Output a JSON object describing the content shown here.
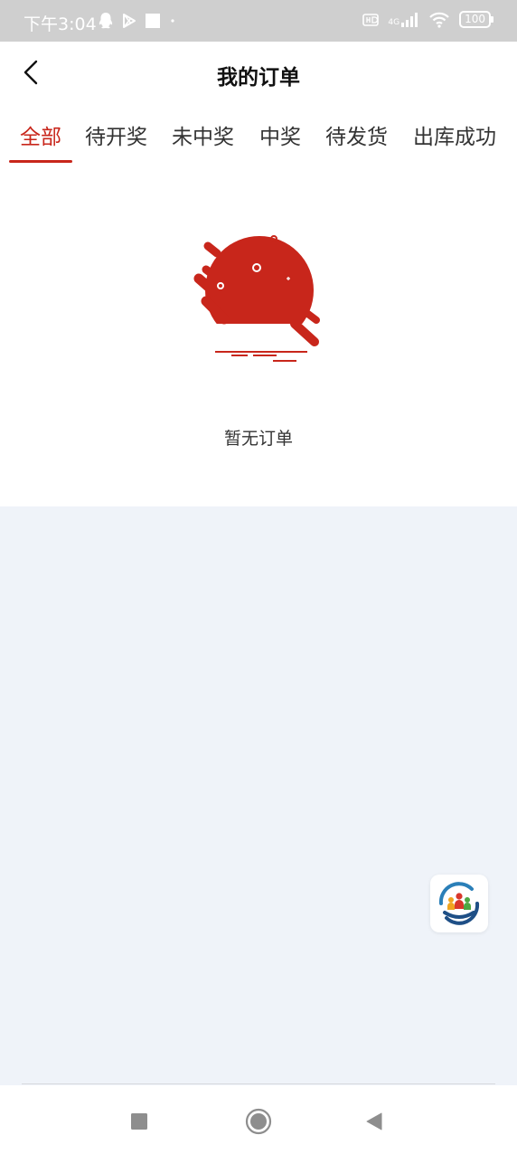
{
  "status_bar": {
    "time": "下午3:04",
    "network": "4G",
    "battery": "100"
  },
  "header": {
    "title": "我的订单"
  },
  "tabs": [
    {
      "label": "全部",
      "active": true
    },
    {
      "label": "待开奖",
      "active": false
    },
    {
      "label": "未中奖",
      "active": false
    },
    {
      "label": "中奖",
      "active": false
    },
    {
      "label": "待发货",
      "active": false
    },
    {
      "label": "出库成功",
      "active": false
    }
  ],
  "empty_state": {
    "message": "暂无订单",
    "icon": "empty-order-illustration"
  },
  "floating_button": {
    "icon": "community-hands-logo-icon"
  },
  "colors": {
    "accent": "#c8261b",
    "background": "#eff3f9",
    "status_bar": "#cfcfcf"
  }
}
